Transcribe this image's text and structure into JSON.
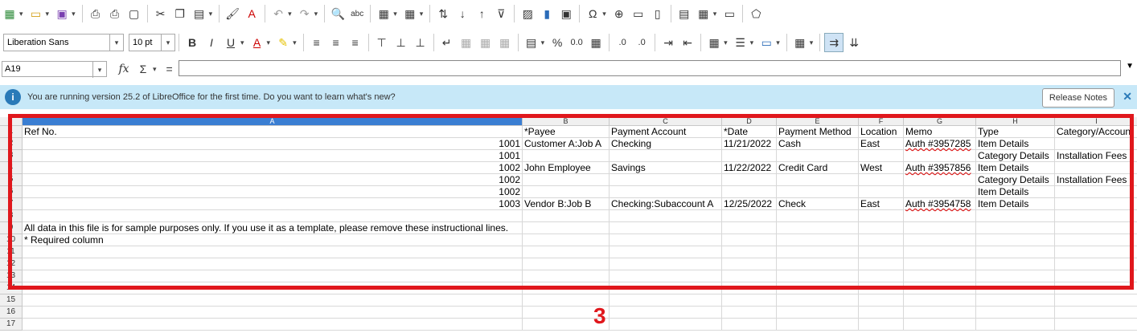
{
  "toolbar": {
    "font_name": "Liberation Sans",
    "font_size": "10 pt",
    "bold": "B",
    "italic": "I",
    "underline": "U",
    "percent": "%",
    "decimal": "0.0",
    "add_decimal": ".0",
    "del_decimal": ".0"
  },
  "formula_bar": {
    "cell_ref": "A19",
    "fx": "fx",
    "sigma": "Σ",
    "equals": "="
  },
  "infobar": {
    "icon": "i",
    "message": "You are running version 25.2 of LibreOffice for the first time. Do you want to learn what's new?",
    "release_notes": "Release Notes",
    "close": "✕"
  },
  "columns": [
    "A",
    "B",
    "C",
    "D",
    "E",
    "F",
    "G",
    "H",
    "I"
  ],
  "row_numbers": [
    "1",
    "2",
    "3",
    "4",
    "5",
    "6",
    "7",
    "8",
    "9",
    "10",
    "11",
    "12",
    "13",
    "14",
    "15",
    "16",
    "17"
  ],
  "rows": [
    [
      "Ref No.",
      "*Payee",
      "Payment Account",
      "*Date",
      "Payment Method",
      "Location",
      "Memo",
      "Type",
      "Category/Account"
    ],
    [
      "1001",
      "Customer A:Job A",
      "Checking",
      "11/21/2022",
      "Cash",
      "East",
      "Auth #3957285",
      "Item Details",
      ""
    ],
    [
      "1001",
      "",
      "",
      "",
      "",
      "",
      "",
      "Category Details",
      "Installation Fees"
    ],
    [
      "1002",
      "John Employee",
      "Savings",
      "11/22/2022",
      "Credit Card",
      "West",
      "Auth #3957856",
      "Item Details",
      ""
    ],
    [
      "1002",
      "",
      "",
      "",
      "",
      "",
      "",
      "Category Details",
      "Installation Fees"
    ],
    [
      "1002",
      "",
      "",
      "",
      "",
      "",
      "",
      "Item Details",
      ""
    ],
    [
      "1003",
      "Vendor B:Job B",
      "Checking:Subaccount A",
      "12/25/2022",
      "Check",
      "East",
      "Auth #3954758",
      "Item Details",
      ""
    ],
    [
      "",
      "",
      "",
      "",
      "",
      "",
      "",
      "",
      ""
    ],
    [
      "All data in this file is for sample purposes only. If you use it as a template, please remove these instructional lines.",
      "",
      "",
      "",
      "",
      "",
      "",
      "",
      ""
    ],
    [
      "* Required column",
      "",
      "",
      "",
      "",
      "",
      "",
      "",
      ""
    ],
    [
      "",
      "",
      "",
      "",
      "",
      "",
      "",
      "",
      ""
    ],
    [
      "",
      "",
      "",
      "",
      "",
      "",
      "",
      "",
      ""
    ],
    [
      "",
      "",
      "",
      "",
      "",
      "",
      "",
      "",
      ""
    ],
    [
      "",
      "",
      "",
      "",
      "",
      "",
      "",
      "",
      ""
    ],
    [
      "",
      "",
      "",
      "",
      "",
      "",
      "",
      "",
      ""
    ],
    [
      "",
      "",
      "",
      "",
      "",
      "",
      "",
      "",
      ""
    ],
    [
      "",
      "",
      "",
      "",
      "",
      "",
      "",
      "",
      ""
    ]
  ],
  "annotation": {
    "marker": "3",
    "color": "#e0171c"
  }
}
